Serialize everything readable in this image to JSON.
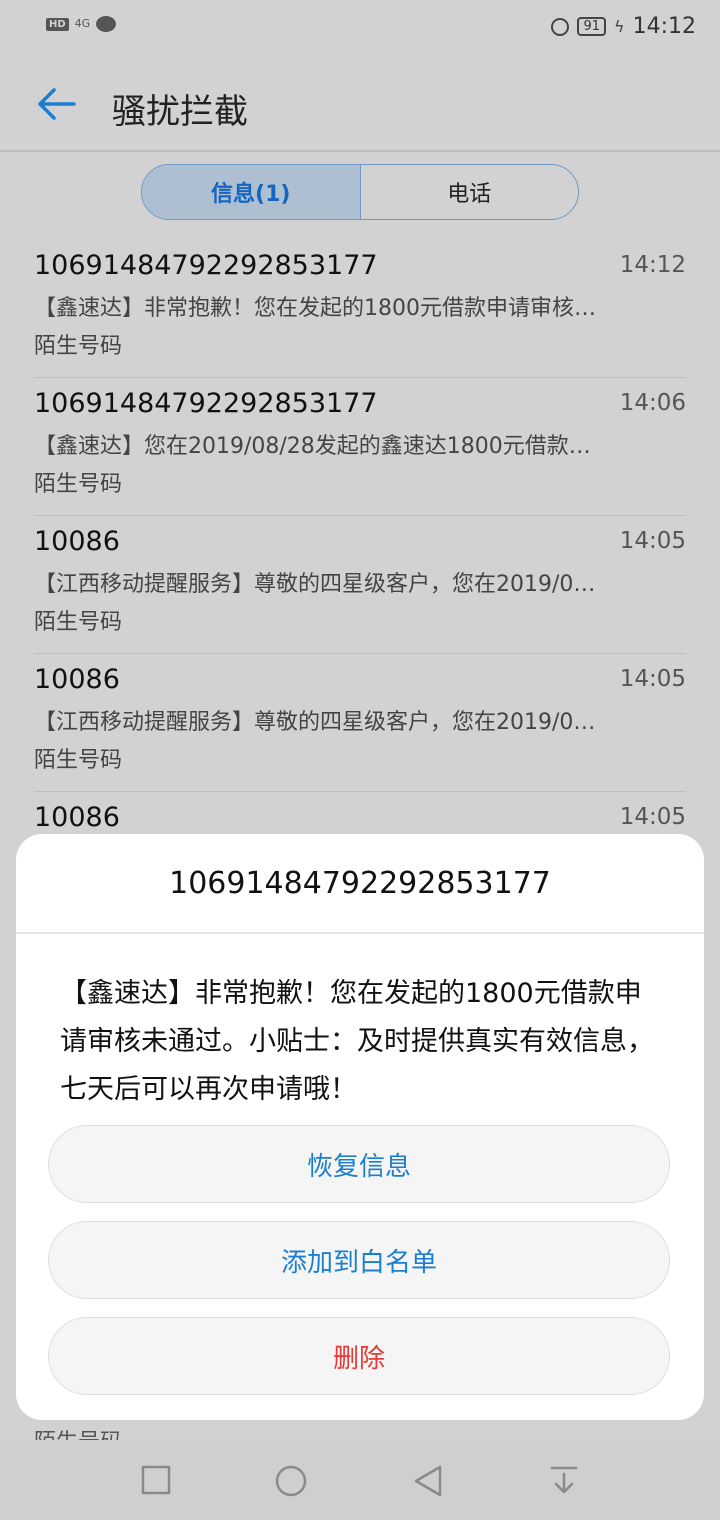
{
  "status_bar": {
    "hd": "HD",
    "network": "4G",
    "battery": "91",
    "time": "14:12"
  },
  "header": {
    "title": "骚扰拦截"
  },
  "tabs": [
    {
      "label": "信息(1)",
      "active": true
    },
    {
      "label": "电话",
      "active": false
    }
  ],
  "messages": [
    {
      "number": "10691484792292853177",
      "time": "14:12",
      "preview": "【鑫速达】非常抱歉！您在发起的1800元借款申请审核…",
      "tag": "陌生号码"
    },
    {
      "number": "10691484792292853177",
      "time": "14:06",
      "preview": "【鑫速达】您在2019/08/28发起的鑫速达1800元借款…",
      "tag": "陌生号码"
    },
    {
      "number": "10086",
      "time": "14:05",
      "preview": "【江西移动提醒服务】尊敬的四星级客户，您在2019/0…",
      "tag": "陌生号码"
    },
    {
      "number": "10086",
      "time": "14:05",
      "preview": "【江西移动提醒服务】尊敬的四星级客户，您在2019/0…",
      "tag": "陌生号码"
    },
    {
      "number": "10086",
      "time": "14:05",
      "preview": "",
      "tag": ""
    }
  ],
  "dialog": {
    "title": "10691484792292853177",
    "message": "【鑫速达】非常抱歉！您在发起的1800元借款申请审核未通过。小贴士：及时提供真实有效信息，七天后可以再次申请哦！",
    "buttons": {
      "restore": "恢复信息",
      "whitelist": "添加到白名单",
      "delete": "删除"
    }
  },
  "bottom_peek": "陌生号码",
  "colors": {
    "accent": "#1b7fd1",
    "danger": "#e53935",
    "tab_active_bg": "#aebfd1"
  }
}
